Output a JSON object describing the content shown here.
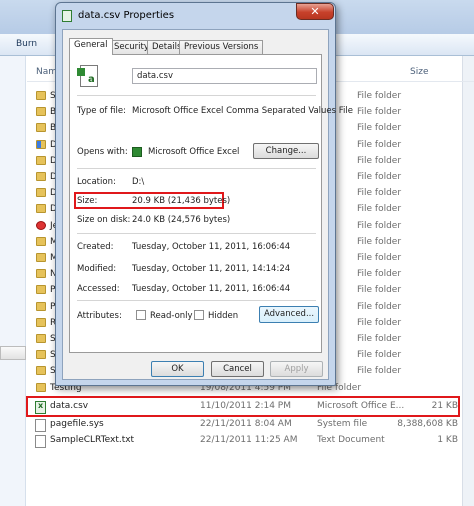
{
  "explorer": {
    "toolbar": {
      "burn_label": "Burn"
    },
    "columns": {
      "name": "Name",
      "size": "Size"
    },
    "folder_type": "File folder",
    "folder_rows": [
      {
        "letter": "S"
      },
      {
        "letter": "B"
      },
      {
        "letter": "B"
      },
      {
        "letter": "D"
      },
      {
        "letter": "D"
      },
      {
        "letter": "D"
      },
      {
        "letter": "D"
      },
      {
        "letter": "D"
      },
      {
        "letter": "Je"
      },
      {
        "letter": "M"
      },
      {
        "letter": "M"
      },
      {
        "letter": "N"
      },
      {
        "letter": "P"
      },
      {
        "letter": "P"
      },
      {
        "letter": "R"
      },
      {
        "letter": "S"
      },
      {
        "letter": "S"
      },
      {
        "letter": "S"
      }
    ],
    "testing_row": {
      "name": "Testing",
      "date": "19/08/2011 4:59 PM",
      "type": "File folder"
    },
    "files": [
      {
        "name": "data.csv",
        "date": "11/10/2011 2:14 PM",
        "type": "Microsoft Office E...",
        "size": "21 KB"
      },
      {
        "name": "pagefile.sys",
        "date": "22/11/2011 8:04 AM",
        "type": "System file",
        "size": "8,388,608 KB"
      },
      {
        "name": "SampleCLRText.txt",
        "date": "22/11/2011 11:25 AM",
        "type": "Text Document",
        "size": "1 KB"
      }
    ]
  },
  "dialog": {
    "title": "data.csv Properties",
    "close_glyph": "✕",
    "tabs": [
      "General",
      "Security",
      "Details",
      "Previous Versions"
    ],
    "file_name": "data.csv",
    "labels": {
      "type_of_file": "Type of file:",
      "opens_with": "Opens with:",
      "location": "Location:",
      "size": "Size:",
      "size_on_disk": "Size on disk:",
      "created": "Created:",
      "modified": "Modified:",
      "accessed": "Accessed:",
      "attributes": "Attributes:"
    },
    "values": {
      "type_of_file": "Microsoft Office Excel Comma Separated Values File",
      "opens_with": "Microsoft Office Excel",
      "location": "D:\\",
      "size": "20.9 KB (21,436 bytes)",
      "size_on_disk": "24.0 KB (24,576 bytes)",
      "created": "Tuesday, October 11, 2011, 16:06:44",
      "modified": "Tuesday, October 11, 2011, 14:14:24",
      "accessed": "Tuesday, October 11, 2011, 16:06:44"
    },
    "buttons": {
      "change": "Change...",
      "advanced": "Advanced...",
      "ok": "OK",
      "cancel": "Cancel",
      "apply": "Apply"
    },
    "attributes": {
      "read_only": "Read-only",
      "hidden": "Hidden"
    }
  }
}
